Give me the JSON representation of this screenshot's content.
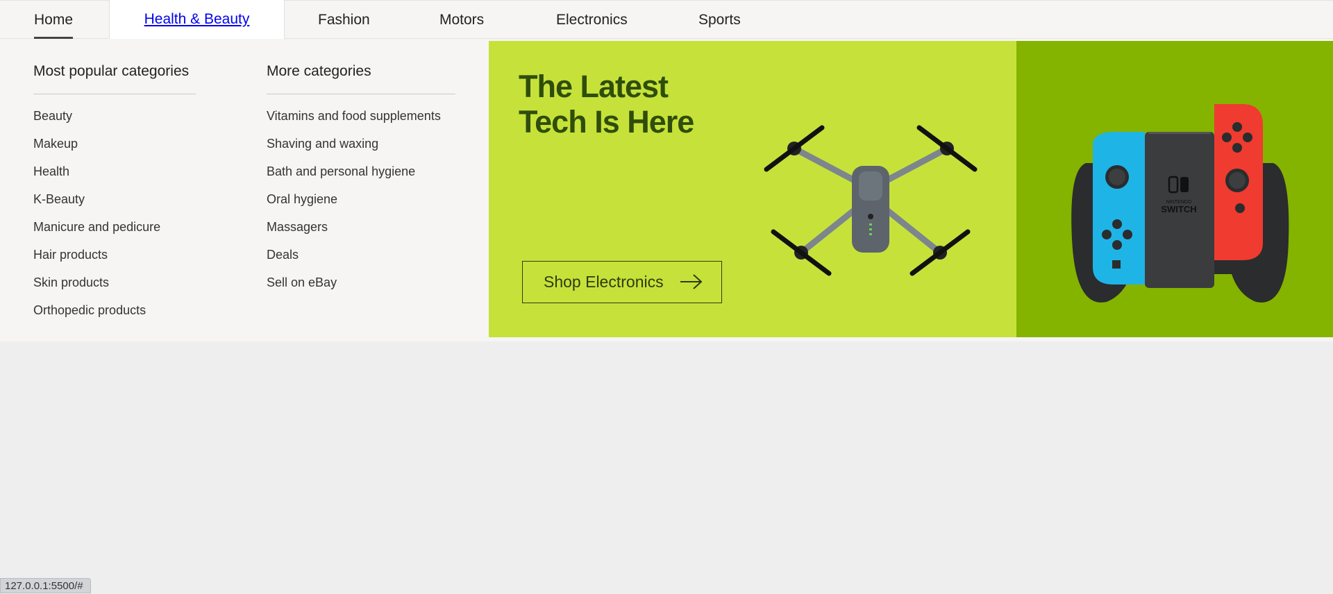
{
  "nav": {
    "items": [
      {
        "label": "Home"
      },
      {
        "label": "Health & Beauty"
      },
      {
        "label": "Fashion"
      },
      {
        "label": "Motors"
      },
      {
        "label": "Electronics"
      },
      {
        "label": "Sports"
      }
    ],
    "selected": "Home",
    "hovered": "Health & Beauty"
  },
  "dropdown": {
    "popular": {
      "title": "Most popular categories",
      "items": [
        "Beauty",
        "Makeup",
        "Health",
        "K-Beauty",
        "Manicure and pedicure",
        "Hair products",
        "Skin products",
        "Orthopedic products"
      ]
    },
    "more": {
      "title": "More categories",
      "items": [
        "Vitamins and food supplements",
        "Shaving and waxing",
        "Bath and personal hygiene",
        "Oral hygiene",
        "Massagers",
        "Deals",
        "Sell on eBay"
      ]
    }
  },
  "banner": {
    "title_line1": "The Latest",
    "title_line2": "Tech Is Here",
    "button_label": "Shop Electronics",
    "colors": {
      "left_bg": "#c6e23a",
      "right_bg": "#84b300",
      "text": "#2f4d0a"
    },
    "switch_logo_line1": "NINTENDO",
    "switch_logo_line2": "SWITCH"
  },
  "status_bar": {
    "url": "127.0.0.1:5500/#"
  }
}
